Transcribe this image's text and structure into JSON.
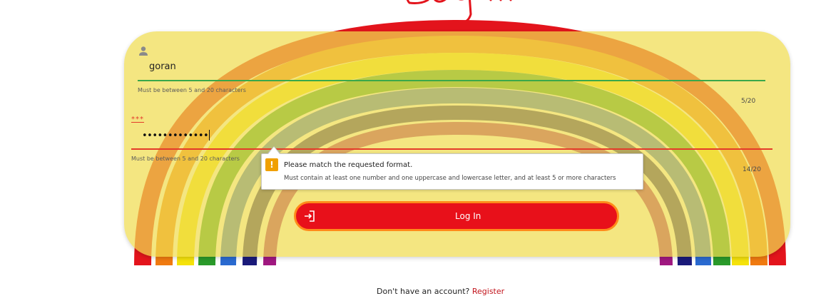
{
  "form": {
    "username": {
      "value": "goran",
      "hint": "Must be between 5 and 20 characters",
      "counter": "5/20"
    },
    "password": {
      "label": "***",
      "value": "•••••••••••••",
      "hint": "Must be between 5 and 20 characters",
      "counter": "14/20"
    },
    "login_button": {
      "label": "Log In",
      "icon": "login-arrow-icon"
    }
  },
  "tooltip": {
    "icon": "warning-icon",
    "title": "Please match the requested format.",
    "detail": "Must contain at least one number and one uppercase and lowercase letter, and at least 5 or more characters"
  },
  "footer": {
    "prompt": "Don't have an account? ",
    "link": "Register"
  },
  "colors": {
    "panel": "#f0dc50",
    "button": "#e8101a",
    "button_border": "#ff8a1a",
    "valid": "#3aa84a",
    "error": "#e43a2a",
    "link": "#c2141c"
  }
}
